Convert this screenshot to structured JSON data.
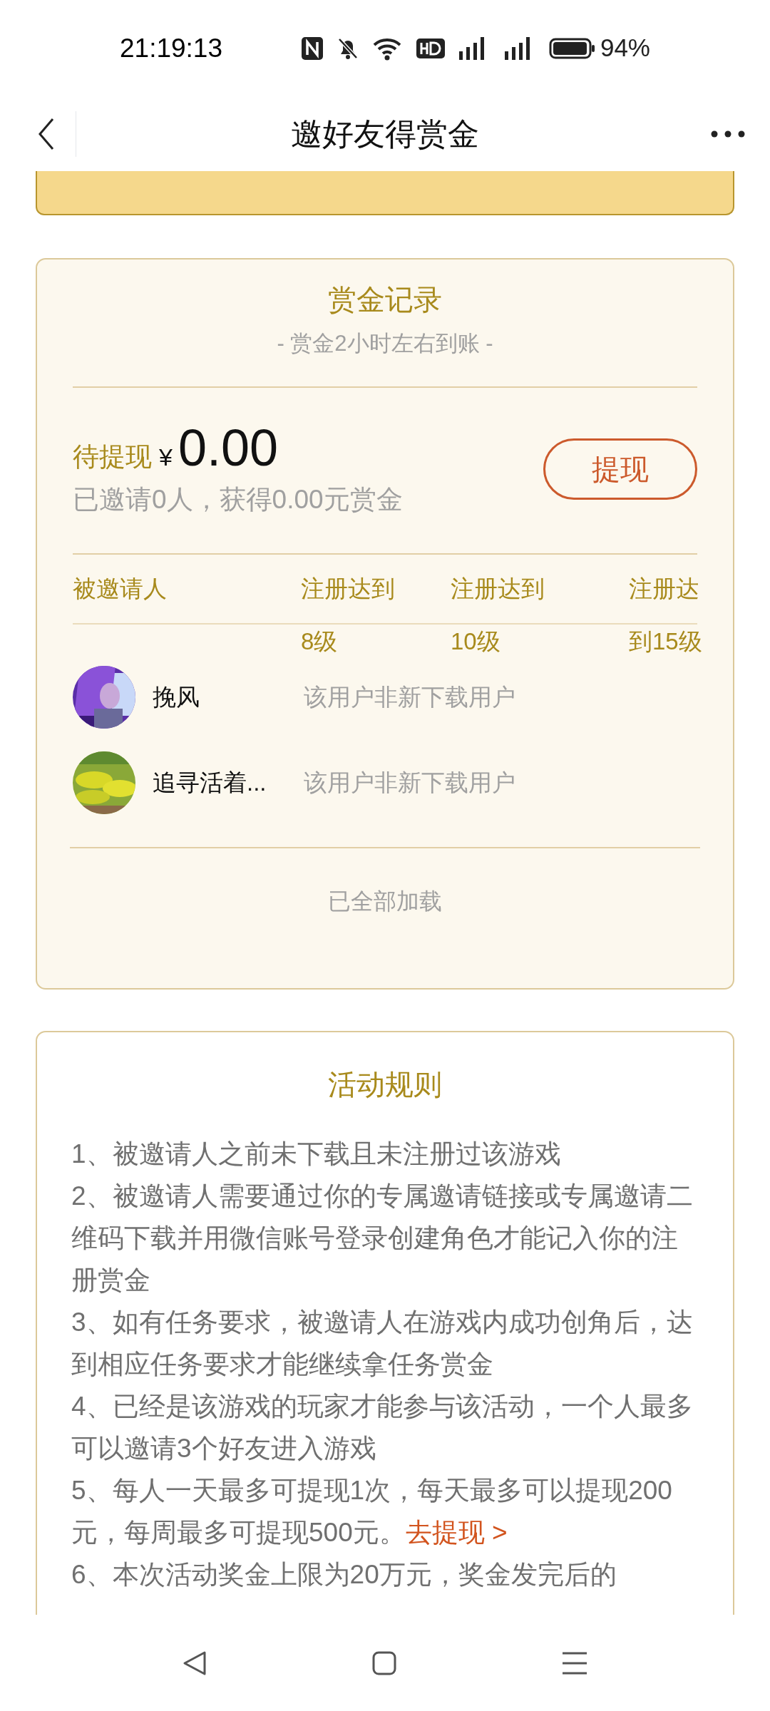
{
  "status_bar": {
    "time": "21:19:13",
    "battery": "94%"
  },
  "header": {
    "title": "邀好友得赏金"
  },
  "records": {
    "title": "赏金记录",
    "subtitle": "- 赏金2小时左右到账 -",
    "pending_label": "待提现",
    "currency": "¥",
    "amount": "0.00",
    "summary": "已邀请0人，获得0.00元赏金",
    "withdraw_button": "提现",
    "columns": [
      {
        "line1": "被邀请人"
      },
      {
        "line1": "注册达到",
        "line2": "8级"
      },
      {
        "line1": "注册达到",
        "line2": "10级"
      },
      {
        "line1": "注册达",
        "line2": "到15级"
      }
    ],
    "rows": [
      {
        "name": "挽风",
        "status": "该用户非新下载用户"
      },
      {
        "name": "追寻活着...",
        "status": "该用户非新下载用户"
      }
    ],
    "footer": "已全部加载"
  },
  "rules": {
    "title": "活动规则",
    "items": [
      {
        "text": "1、被邀请人之前未下载且未注册过该游戏"
      },
      {
        "text": "2、被邀请人需要通过你的专属邀请链接或专属邀请二维码下载并用微信账号登录创建角色才能记入你的注册赏金"
      },
      {
        "text": "3、如有任务要求，被邀请人在游戏内成功创角后，达到相应任务要求才能继续拿任务赏金"
      },
      {
        "text": "4、已经是该游戏的玩家才能参与该活动，一个人最多可以邀请3个好友进入游戏"
      },
      {
        "text": "5、每人一天最多可提现1次，每天最多可以提现200元，每周最多可提现500元。",
        "link": "去提现 >"
      },
      {
        "text": "6、本次活动奖金上限为20万元，奖金发完后的"
      }
    ]
  }
}
